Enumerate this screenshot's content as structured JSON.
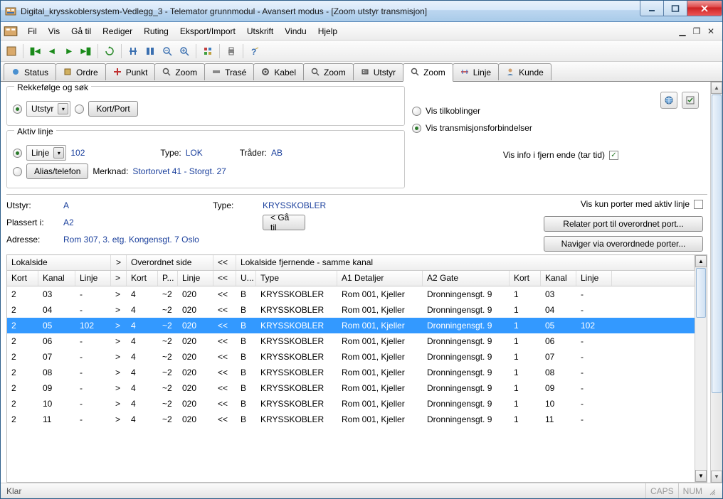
{
  "window": {
    "title": "Digital_krysskoblersystem-Vedlegg_3 - Telemator grunnmodul - Avansert modus - [Zoom utstyr transmisjon]"
  },
  "menu": {
    "items": [
      "Fil",
      "Vis",
      "Gå til",
      "Rediger",
      "Ruting",
      "Eksport/Import",
      "Utskrift",
      "Vindu",
      "Hjelp"
    ]
  },
  "tabs": [
    {
      "label": "Status"
    },
    {
      "label": "Ordre"
    },
    {
      "label": "Punkt"
    },
    {
      "label": "Zoom"
    },
    {
      "label": "Trasé"
    },
    {
      "label": "Kabel"
    },
    {
      "label": "Zoom"
    },
    {
      "label": "Utstyr"
    },
    {
      "label": "Zoom",
      "active": true
    },
    {
      "label": "Linje"
    },
    {
      "label": "Kunde"
    }
  ],
  "search": {
    "group_title": "Rekkefølge og søk",
    "utstyr_label": "Utstyr",
    "kortport_label": "Kort/Port"
  },
  "aktiv": {
    "group_title": "Aktiv linje",
    "linje_label": "Linje",
    "linje_value": "102",
    "type_label": "Type:",
    "type_value": "LOK",
    "trader_label": "Tråder:",
    "trader_value": "AB",
    "alias_label": "Alias/telefon",
    "merknad_label": "Merknad:",
    "merknad_value": "Stortorvet 41 - Storgt. 27"
  },
  "rightopts": {
    "vis_tilk": "Vis tilkoblinger",
    "vis_trans": "Vis transmisjonsforbindelser",
    "vis_info": "Vis info i fjern ende (tar tid)"
  },
  "info": {
    "utstyr_label": "Utstyr:",
    "utstyr_value": "A",
    "type_label": "Type:",
    "type_value": "KRYSSKOBLER",
    "plassert_label": "Plassert i:",
    "plassert_value": "A2",
    "adresse_label": "Adresse:",
    "adresse_value": "Rom 307, 3. etg. Kongensgt. 7 Oslo",
    "gatil": "< Gå til",
    "vis_kun": "Vis kun porter med aktiv linje",
    "relater": "Relater port til overordnet port...",
    "naviger": "Naviger via overordnede porter..."
  },
  "table": {
    "groups": {
      "lokal": "Lokalside",
      "over": "Overordnet side",
      "fjern": "Lokalside fjernende - samme kanal",
      "ar": ">",
      "al": "<<"
    },
    "cols": [
      "Kort",
      "Kanal",
      "Linje",
      ">",
      "Kort",
      "P...",
      "Linje",
      "<<",
      "U...",
      "Type",
      "A1 Detaljer",
      "A2 Gate",
      "Kort",
      "Kanal",
      "Linje"
    ],
    "rows": [
      {
        "kort": "2",
        "kanal": "03",
        "linje": "-",
        "ar": ">",
        "kort2": "4",
        "p": "~2",
        "linje2": "020",
        "al": "<<",
        "u": "B",
        "type": "KRYSSKOBLER",
        "a1": "Rom 001, Kjeller",
        "a2": "Dronningensgt. 9",
        "kort3": "1",
        "kanal3": "03",
        "linje3": "-"
      },
      {
        "kort": "2",
        "kanal": "04",
        "linje": "-",
        "ar": ">",
        "kort2": "4",
        "p": "~2",
        "linje2": "020",
        "al": "<<",
        "u": "B",
        "type": "KRYSSKOBLER",
        "a1": "Rom 001, Kjeller",
        "a2": "Dronningensgt. 9",
        "kort3": "1",
        "kanal3": "04",
        "linje3": "-"
      },
      {
        "kort": "2",
        "kanal": "05",
        "linje": "102",
        "ar": ">",
        "kort2": "4",
        "p": "~2",
        "linje2": "020",
        "al": "<<",
        "u": "B",
        "type": "KRYSSKOBLER",
        "a1": "Rom 001, Kjeller",
        "a2": "Dronningensgt. 9",
        "kort3": "1",
        "kanal3": "05",
        "linje3": "102",
        "selected": true
      },
      {
        "kort": "2",
        "kanal": "06",
        "linje": "-",
        "ar": ">",
        "kort2": "4",
        "p": "~2",
        "linje2": "020",
        "al": "<<",
        "u": "B",
        "type": "KRYSSKOBLER",
        "a1": "Rom 001, Kjeller",
        "a2": "Dronningensgt. 9",
        "kort3": "1",
        "kanal3": "06",
        "linje3": "-"
      },
      {
        "kort": "2",
        "kanal": "07",
        "linje": "-",
        "ar": ">",
        "kort2": "4",
        "p": "~2",
        "linje2": "020",
        "al": "<<",
        "u": "B",
        "type": "KRYSSKOBLER",
        "a1": "Rom 001, Kjeller",
        "a2": "Dronningensgt. 9",
        "kort3": "1",
        "kanal3": "07",
        "linje3": "-"
      },
      {
        "kort": "2",
        "kanal": "08",
        "linje": "-",
        "ar": ">",
        "kort2": "4",
        "p": "~2",
        "linje2": "020",
        "al": "<<",
        "u": "B",
        "type": "KRYSSKOBLER",
        "a1": "Rom 001, Kjeller",
        "a2": "Dronningensgt. 9",
        "kort3": "1",
        "kanal3": "08",
        "linje3": "-"
      },
      {
        "kort": "2",
        "kanal": "09",
        "linje": "-",
        "ar": ">",
        "kort2": "4",
        "p": "~2",
        "linje2": "020",
        "al": "<<",
        "u": "B",
        "type": "KRYSSKOBLER",
        "a1": "Rom 001, Kjeller",
        "a2": "Dronningensgt. 9",
        "kort3": "1",
        "kanal3": "09",
        "linje3": "-"
      },
      {
        "kort": "2",
        "kanal": "10",
        "linje": "-",
        "ar": ">",
        "kort2": "4",
        "p": "~2",
        "linje2": "020",
        "al": "<<",
        "u": "B",
        "type": "KRYSSKOBLER",
        "a1": "Rom 001, Kjeller",
        "a2": "Dronningensgt. 9",
        "kort3": "1",
        "kanal3": "10",
        "linje3": "-"
      },
      {
        "kort": "2",
        "kanal": "11",
        "linje": "-",
        "ar": ">",
        "kort2": "4",
        "p": "~2",
        "linje2": "020",
        "al": "<<",
        "u": "B",
        "type": "KRYSSKOBLER",
        "a1": "Rom 001, Kjeller",
        "a2": "Dronningensgt. 9",
        "kort3": "1",
        "kanal3": "11",
        "linje3": "-"
      }
    ]
  },
  "status": {
    "ready": "Klar",
    "caps": "CAPS",
    "num": "NUM"
  }
}
